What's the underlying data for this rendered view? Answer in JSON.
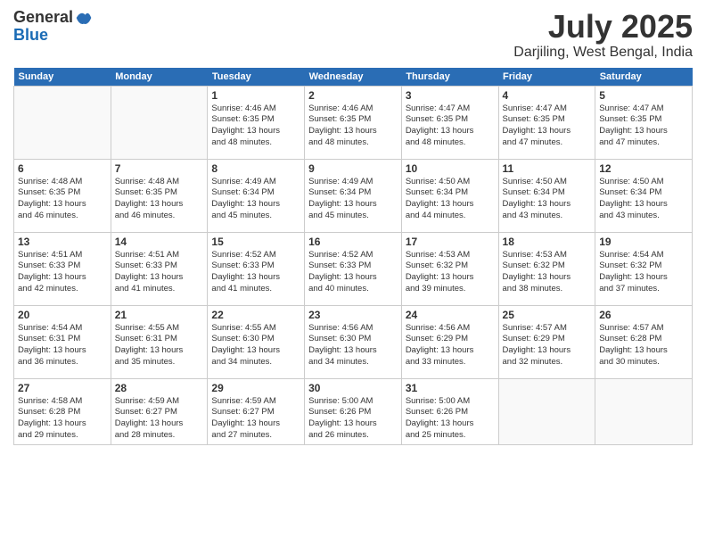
{
  "header": {
    "logo_line1": "General",
    "logo_line2": "Blue",
    "title": "July 2025",
    "location": "Darjiling, West Bengal, India"
  },
  "weekdays": [
    "Sunday",
    "Monday",
    "Tuesday",
    "Wednesday",
    "Thursday",
    "Friday",
    "Saturday"
  ],
  "weeks": [
    [
      {
        "day": "",
        "sunrise": "",
        "sunset": "",
        "daylight": ""
      },
      {
        "day": "",
        "sunrise": "",
        "sunset": "",
        "daylight": ""
      },
      {
        "day": "1",
        "sunrise": "Sunrise: 4:46 AM",
        "sunset": "Sunset: 6:35 PM",
        "daylight": "Daylight: 13 hours and 48 minutes."
      },
      {
        "day": "2",
        "sunrise": "Sunrise: 4:46 AM",
        "sunset": "Sunset: 6:35 PM",
        "daylight": "Daylight: 13 hours and 48 minutes."
      },
      {
        "day": "3",
        "sunrise": "Sunrise: 4:47 AM",
        "sunset": "Sunset: 6:35 PM",
        "daylight": "Daylight: 13 hours and 48 minutes."
      },
      {
        "day": "4",
        "sunrise": "Sunrise: 4:47 AM",
        "sunset": "Sunset: 6:35 PM",
        "daylight": "Daylight: 13 hours and 47 minutes."
      },
      {
        "day": "5",
        "sunrise": "Sunrise: 4:47 AM",
        "sunset": "Sunset: 6:35 PM",
        "daylight": "Daylight: 13 hours and 47 minutes."
      }
    ],
    [
      {
        "day": "6",
        "sunrise": "Sunrise: 4:48 AM",
        "sunset": "Sunset: 6:35 PM",
        "daylight": "Daylight: 13 hours and 46 minutes."
      },
      {
        "day": "7",
        "sunrise": "Sunrise: 4:48 AM",
        "sunset": "Sunset: 6:35 PM",
        "daylight": "Daylight: 13 hours and 46 minutes."
      },
      {
        "day": "8",
        "sunrise": "Sunrise: 4:49 AM",
        "sunset": "Sunset: 6:34 PM",
        "daylight": "Daylight: 13 hours and 45 minutes."
      },
      {
        "day": "9",
        "sunrise": "Sunrise: 4:49 AM",
        "sunset": "Sunset: 6:34 PM",
        "daylight": "Daylight: 13 hours and 45 minutes."
      },
      {
        "day": "10",
        "sunrise": "Sunrise: 4:50 AM",
        "sunset": "Sunset: 6:34 PM",
        "daylight": "Daylight: 13 hours and 44 minutes."
      },
      {
        "day": "11",
        "sunrise": "Sunrise: 4:50 AM",
        "sunset": "Sunset: 6:34 PM",
        "daylight": "Daylight: 13 hours and 43 minutes."
      },
      {
        "day": "12",
        "sunrise": "Sunrise: 4:50 AM",
        "sunset": "Sunset: 6:34 PM",
        "daylight": "Daylight: 13 hours and 43 minutes."
      }
    ],
    [
      {
        "day": "13",
        "sunrise": "Sunrise: 4:51 AM",
        "sunset": "Sunset: 6:33 PM",
        "daylight": "Daylight: 13 hours and 42 minutes."
      },
      {
        "day": "14",
        "sunrise": "Sunrise: 4:51 AM",
        "sunset": "Sunset: 6:33 PM",
        "daylight": "Daylight: 13 hours and 41 minutes."
      },
      {
        "day": "15",
        "sunrise": "Sunrise: 4:52 AM",
        "sunset": "Sunset: 6:33 PM",
        "daylight": "Daylight: 13 hours and 41 minutes."
      },
      {
        "day": "16",
        "sunrise": "Sunrise: 4:52 AM",
        "sunset": "Sunset: 6:33 PM",
        "daylight": "Daylight: 13 hours and 40 minutes."
      },
      {
        "day": "17",
        "sunrise": "Sunrise: 4:53 AM",
        "sunset": "Sunset: 6:32 PM",
        "daylight": "Daylight: 13 hours and 39 minutes."
      },
      {
        "day": "18",
        "sunrise": "Sunrise: 4:53 AM",
        "sunset": "Sunset: 6:32 PM",
        "daylight": "Daylight: 13 hours and 38 minutes."
      },
      {
        "day": "19",
        "sunrise": "Sunrise: 4:54 AM",
        "sunset": "Sunset: 6:32 PM",
        "daylight": "Daylight: 13 hours and 37 minutes."
      }
    ],
    [
      {
        "day": "20",
        "sunrise": "Sunrise: 4:54 AM",
        "sunset": "Sunset: 6:31 PM",
        "daylight": "Daylight: 13 hours and 36 minutes."
      },
      {
        "day": "21",
        "sunrise": "Sunrise: 4:55 AM",
        "sunset": "Sunset: 6:31 PM",
        "daylight": "Daylight: 13 hours and 35 minutes."
      },
      {
        "day": "22",
        "sunrise": "Sunrise: 4:55 AM",
        "sunset": "Sunset: 6:30 PM",
        "daylight": "Daylight: 13 hours and 34 minutes."
      },
      {
        "day": "23",
        "sunrise": "Sunrise: 4:56 AM",
        "sunset": "Sunset: 6:30 PM",
        "daylight": "Daylight: 13 hours and 34 minutes."
      },
      {
        "day": "24",
        "sunrise": "Sunrise: 4:56 AM",
        "sunset": "Sunset: 6:29 PM",
        "daylight": "Daylight: 13 hours and 33 minutes."
      },
      {
        "day": "25",
        "sunrise": "Sunrise: 4:57 AM",
        "sunset": "Sunset: 6:29 PM",
        "daylight": "Daylight: 13 hours and 32 minutes."
      },
      {
        "day": "26",
        "sunrise": "Sunrise: 4:57 AM",
        "sunset": "Sunset: 6:28 PM",
        "daylight": "Daylight: 13 hours and 30 minutes."
      }
    ],
    [
      {
        "day": "27",
        "sunrise": "Sunrise: 4:58 AM",
        "sunset": "Sunset: 6:28 PM",
        "daylight": "Daylight: 13 hours and 29 minutes."
      },
      {
        "day": "28",
        "sunrise": "Sunrise: 4:59 AM",
        "sunset": "Sunset: 6:27 PM",
        "daylight": "Daylight: 13 hours and 28 minutes."
      },
      {
        "day": "29",
        "sunrise": "Sunrise: 4:59 AM",
        "sunset": "Sunset: 6:27 PM",
        "daylight": "Daylight: 13 hours and 27 minutes."
      },
      {
        "day": "30",
        "sunrise": "Sunrise: 5:00 AM",
        "sunset": "Sunset: 6:26 PM",
        "daylight": "Daylight: 13 hours and 26 minutes."
      },
      {
        "day": "31",
        "sunrise": "Sunrise: 5:00 AM",
        "sunset": "Sunset: 6:26 PM",
        "daylight": "Daylight: 13 hours and 25 minutes."
      },
      {
        "day": "",
        "sunrise": "",
        "sunset": "",
        "daylight": ""
      },
      {
        "day": "",
        "sunrise": "",
        "sunset": "",
        "daylight": ""
      }
    ]
  ]
}
